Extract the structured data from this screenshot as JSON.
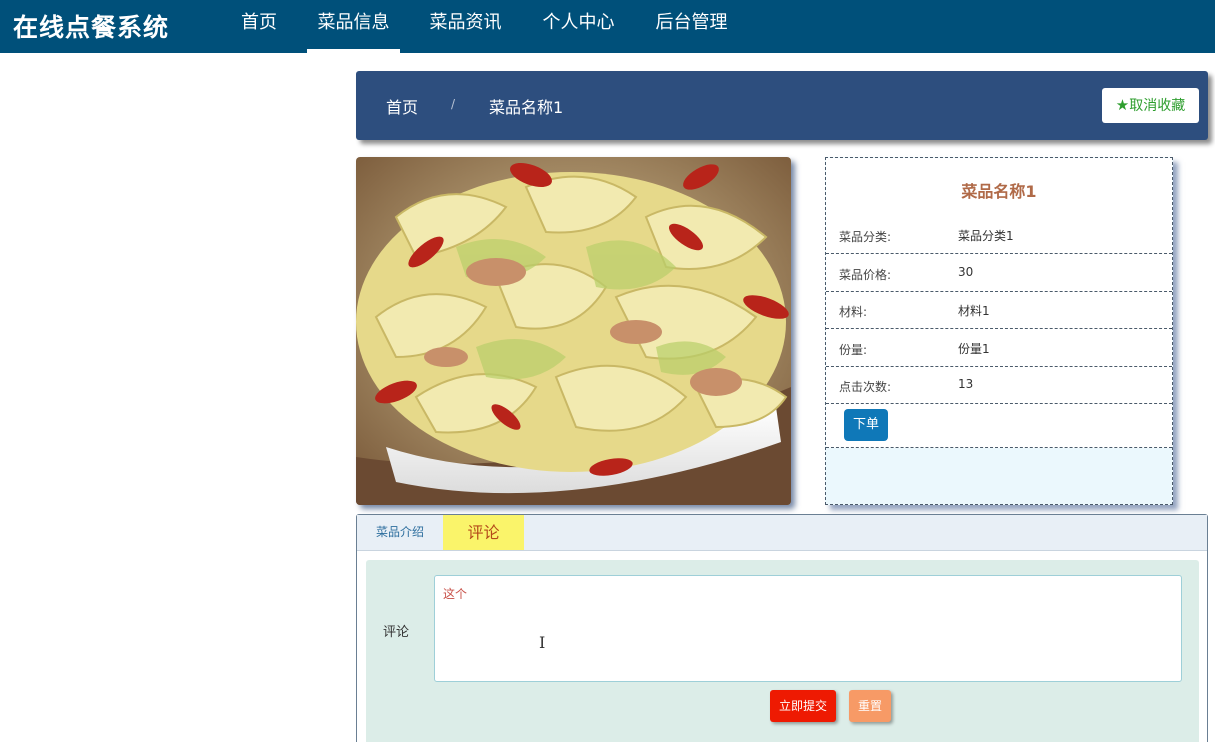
{
  "app": {
    "title": "在线点餐系统"
  },
  "nav": {
    "items": [
      {
        "label": "首页"
      },
      {
        "label": "菜品信息",
        "active": true
      },
      {
        "label": "菜品资讯"
      },
      {
        "label": "个人中心"
      },
      {
        "label": "后台管理"
      }
    ]
  },
  "breadcrumb": {
    "home": "首页",
    "separator": "/",
    "current": "菜品名称1"
  },
  "favorite": {
    "icon": "star-icon",
    "label": "取消收藏",
    "color": "#2e9e2e"
  },
  "dish": {
    "image_icon": "dish-photo",
    "name": "菜品名称1",
    "fields": [
      {
        "key": "菜品分类:",
        "value": "菜品分类1"
      },
      {
        "key": "菜品价格:",
        "value": "30"
      },
      {
        "key": "材料:",
        "value": "材料1"
      },
      {
        "key": "份量:",
        "value": "份量1"
      },
      {
        "key": "点击次数:",
        "value": "13"
      }
    ],
    "order_label": "下单"
  },
  "tabs": {
    "items": [
      {
        "label": "菜品介绍"
      },
      {
        "label": "评论",
        "active": true
      }
    ]
  },
  "comment": {
    "label": "评论",
    "value": "这个",
    "submit_label": "立即提交",
    "reset_label": "重置"
  },
  "colors": {
    "nav_bg": "#00507a",
    "breadcrumb_bg": "#2d4e7e",
    "submit": "#ee1a02",
    "reset": "#f79a66",
    "order": "#0f78b8"
  }
}
